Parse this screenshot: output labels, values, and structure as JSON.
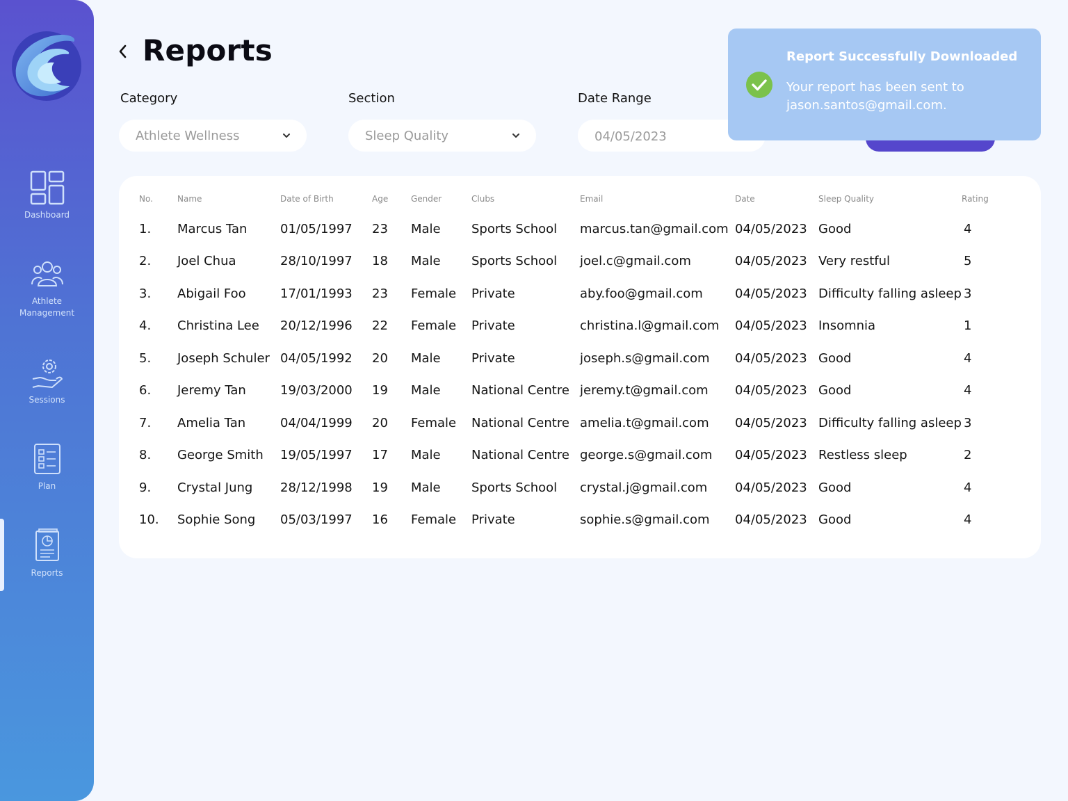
{
  "nav": {
    "items": [
      {
        "label": "Dashboard",
        "icon": "dashboard-icon"
      },
      {
        "label": "Athlete Management",
        "icon": "team-icon"
      },
      {
        "label": "Sessions",
        "icon": "sessions-icon"
      },
      {
        "label": "Plan",
        "icon": "checklist-icon"
      },
      {
        "label": "Reports",
        "icon": "report-icon",
        "active": true
      }
    ]
  },
  "header": {
    "title": "Reports"
  },
  "filters": {
    "category": {
      "label": "Category",
      "value": "Athlete Wellness"
    },
    "section": {
      "label": "Section",
      "value": "Sleep Quality"
    },
    "date_range": {
      "label": "Date Range",
      "value": "04/05/2023"
    }
  },
  "table": {
    "columns": [
      "No.",
      "Name",
      "Date of Birth",
      "Age",
      "Gender",
      "Clubs",
      "Email",
      "Date",
      "Sleep Quality",
      "Rating"
    ],
    "rows": [
      [
        "1.",
        "Marcus Tan",
        "01/05/1997",
        "23",
        "Male",
        "Sports School",
        "marcus.tan@gmail.com",
        "04/05/2023",
        "Good",
        "4"
      ],
      [
        "2.",
        "Joel Chua",
        "28/10/1997",
        "18",
        "Male",
        "Sports School",
        "joel.c@gmail.com",
        "04/05/2023",
        "Very restful",
        "5"
      ],
      [
        "3.",
        "Abigail Foo",
        "17/01/1993",
        "23",
        "Female",
        "Private",
        "aby.foo@gmail.com",
        "04/05/2023",
        "Difficulty falling asleep",
        "3"
      ],
      [
        "4.",
        "Christina Lee",
        "20/12/1996",
        "22",
        "Female",
        "Private",
        "christina.l@gmail.com",
        "04/05/2023",
        "Insomnia",
        "1"
      ],
      [
        "5.",
        "Joseph Schuler",
        "04/05/1992",
        "20",
        "Male",
        "Private",
        "joseph.s@gmail.com",
        "04/05/2023",
        "Good",
        "4"
      ],
      [
        "6.",
        "Jeremy Tan",
        "19/03/2000",
        "19",
        "Male",
        "National Centre",
        "jeremy.t@gmail.com",
        "04/05/2023",
        "Good",
        "4"
      ],
      [
        "7.",
        "Amelia Tan",
        "04/04/1999",
        "20",
        "Female",
        "National Centre",
        "amelia.t@gmail.com",
        "04/05/2023",
        "Difficulty falling asleep",
        "3"
      ],
      [
        "8.",
        "George Smith",
        "19/05/1997",
        "17",
        "Male",
        "National Centre",
        "george.s@gmail.com",
        "04/05/2023",
        "Restless sleep",
        "2"
      ],
      [
        "9.",
        "Crystal Jung",
        "28/12/1998",
        "19",
        "Male",
        "Sports School",
        "crystal.j@gmail.com",
        "04/05/2023",
        "Good",
        "4"
      ],
      [
        "10.",
        "Sophie Song",
        "05/03/1997",
        "16",
        "Female",
        "Private",
        "sophie.s@gmail.com",
        "04/05/2023",
        "Good",
        "4"
      ]
    ]
  },
  "toast": {
    "title": "Report Successfully Downloaded",
    "message": "Your report has been sent to jason.santos@gmail.com.",
    "icon": "check-circle-icon"
  },
  "colors": {
    "sidebar_top": "#5a52cf",
    "sidebar_bottom": "#4a97de",
    "primary_button": "#5546cc",
    "toast_bg": "#a6c8f3",
    "success": "#7bc24b",
    "page_bg": "#f3f7fe"
  }
}
